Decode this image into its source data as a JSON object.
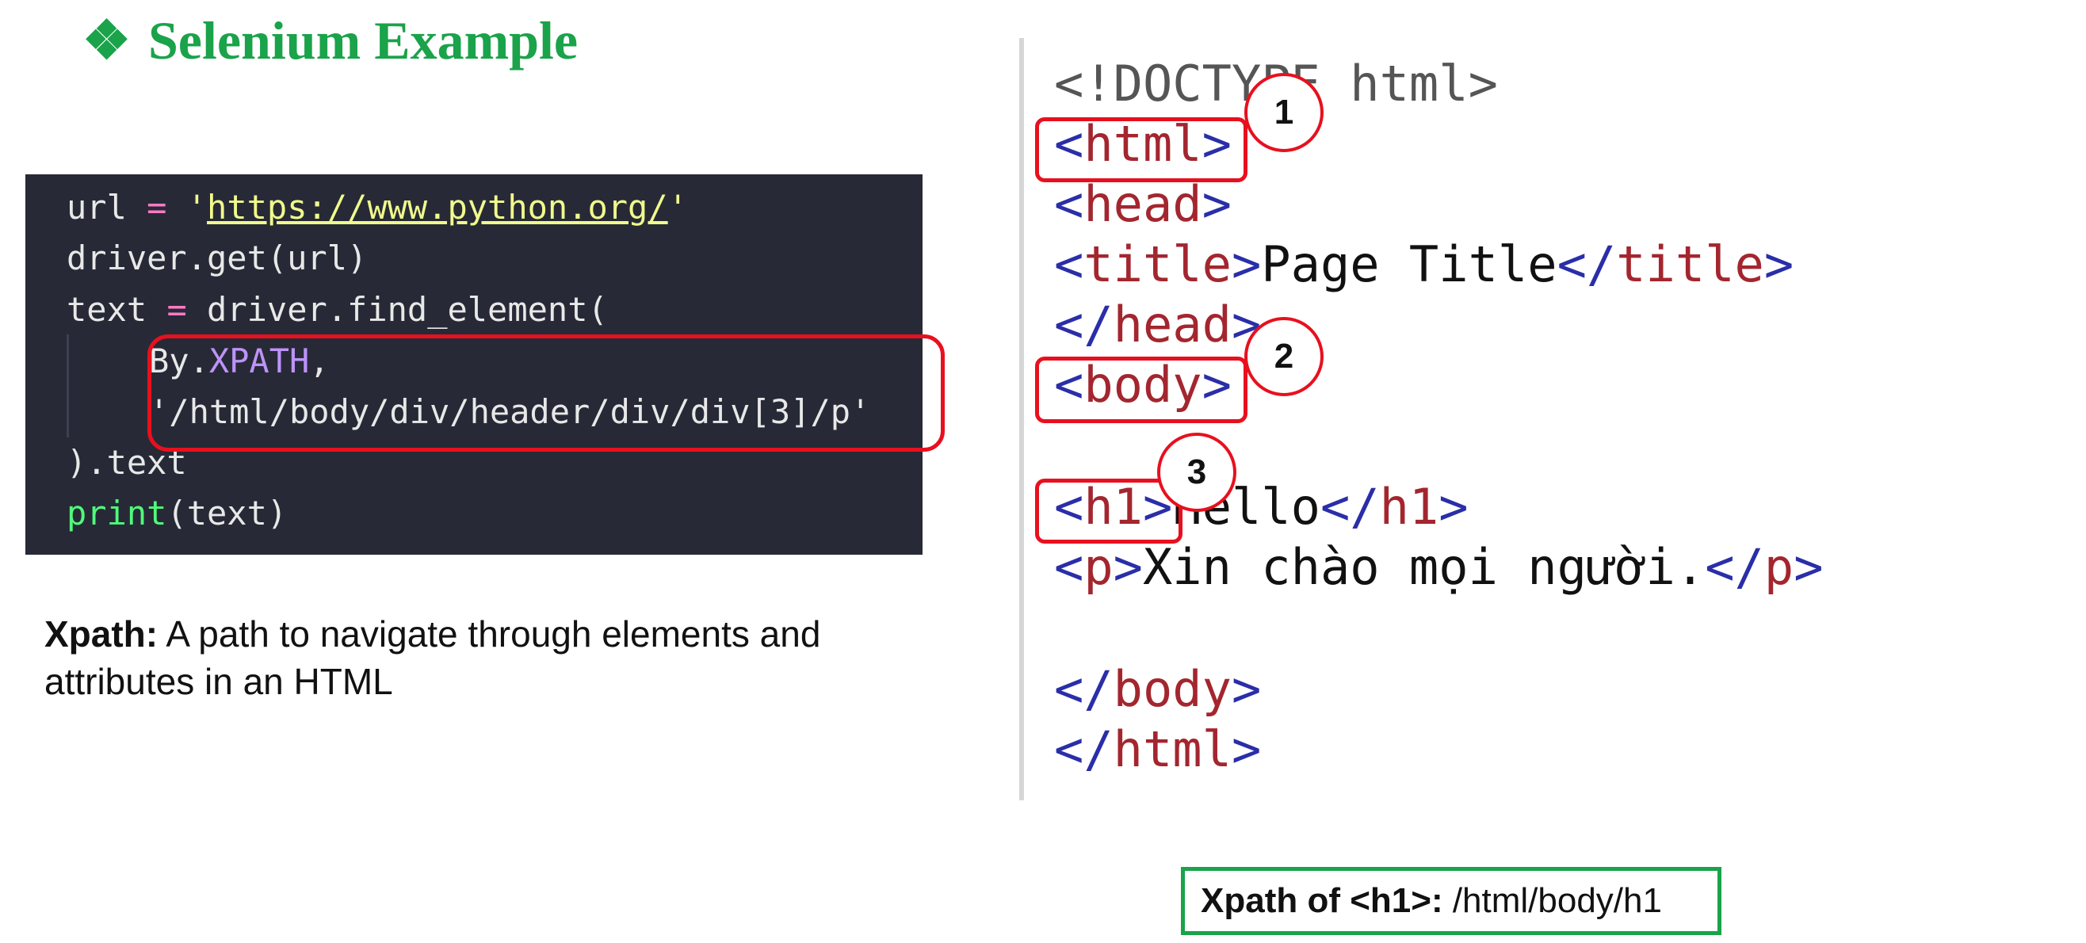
{
  "title": {
    "bullet": "❖",
    "text": "Selenium Example"
  },
  "code": {
    "line1": {
      "var": "url",
      "op": "=",
      "q1": "'",
      "url": "https://www.python.org/",
      "q2": "'"
    },
    "line2": "driver.get(url)",
    "line3": {
      "var": "text",
      "op": "=",
      "call": "driver.find_element("
    },
    "line4": {
      "by": "By.",
      "const": "XPATH",
      "comma": ","
    },
    "line5": "'/html/body/div/header/div/div[3]/p'",
    "line6": ").text",
    "line7": {
      "fn": "print",
      "args": "(text)"
    }
  },
  "description": {
    "label": "Xpath:",
    "text": " A path to navigate through elements and attributes in an HTML"
  },
  "source": {
    "doctype": "<!DOCTYPE html>",
    "html_open": "html",
    "head_open": "head",
    "title_tag": "title",
    "title_text": "Page Title",
    "head_close": "head",
    "body_open": "body",
    "h1_tag": "h1",
    "h1_text": "Hello",
    "p_tag": "p",
    "p_text": "Xin chào mọi người.",
    "body_close": "body",
    "html_close": "html"
  },
  "markers": [
    "1",
    "2",
    "3"
  ],
  "answer": {
    "label": "Xpath of <h1>:",
    "value": " /html/body/h1"
  },
  "colors": {
    "title_green": "#1aa34a",
    "highlight_red": "#e8101e",
    "code_bg": "#272a36"
  }
}
